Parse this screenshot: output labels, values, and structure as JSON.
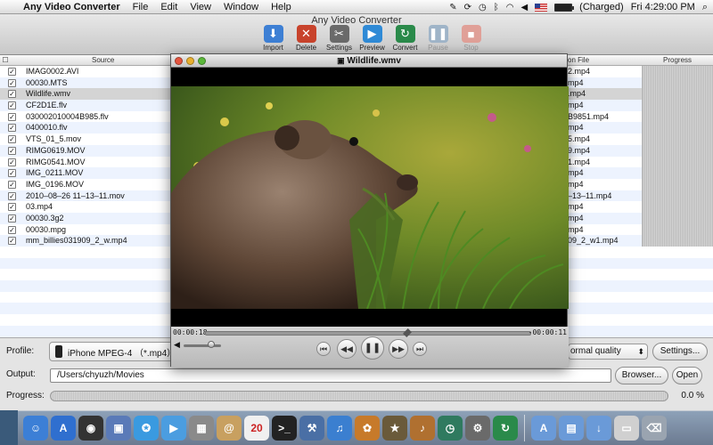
{
  "menubar": {
    "app_name": "Any Video Converter",
    "items": [
      "File",
      "Edit",
      "View",
      "Window",
      "Help"
    ],
    "battery": "(Charged)",
    "clock": "Fri 4:29:00 PM"
  },
  "window": {
    "title": "Any Video Converter"
  },
  "toolbar": {
    "buttons": [
      {
        "label": "Import",
        "icon": "import-icon",
        "color": "#3d7fd4"
      },
      {
        "label": "Delete",
        "icon": "delete-icon",
        "color": "#c8432c"
      },
      {
        "label": "Settings",
        "icon": "settings-icon",
        "color": "#6a6a6a"
      },
      {
        "label": "Preview",
        "icon": "preview-icon",
        "color": "#2f8ad6"
      },
      {
        "label": "Convert",
        "icon": "convert-icon",
        "color": "#2a8a4a"
      },
      {
        "label": "Pause",
        "icon": "pause-icon",
        "color": "#9fb4c8"
      },
      {
        "label": "Stop",
        "icon": "stop-icon",
        "color": "#e0a098"
      }
    ]
  },
  "table": {
    "headers": {
      "source": "Source",
      "dest": "on File",
      "progress": "Progress"
    },
    "rows": [
      {
        "source": "IMAG0002.AVI",
        "dest": "2.mp4",
        "checked": "✓"
      },
      {
        "source": "00030.MTS",
        "dest": "mp4",
        "checked": "✓"
      },
      {
        "source": "Wildlife.wmv",
        "dest": ".mp4",
        "checked": "✓"
      },
      {
        "source": "CF2D1E.flv",
        "dest": "mp4",
        "checked": "✓"
      },
      {
        "source": "030002010004B985.flv",
        "dest": "B9851.mp4",
        "checked": "✓"
      },
      {
        "source": "0400010.flv",
        "dest": "mp4",
        "checked": "✓"
      },
      {
        "source": "VTS_01_5.mov",
        "dest": "5.mp4",
        "checked": "✓"
      },
      {
        "source": "RIMG0619.MOV",
        "dest": "9.mp4",
        "checked": "✓"
      },
      {
        "source": "RIMG0541.MOV",
        "dest": "1.mp4",
        "checked": "✓"
      },
      {
        "source": "IMG_0211.MOV",
        "dest": "mp4",
        "checked": "✓"
      },
      {
        "source": "IMG_0196.MOV",
        "dest": "mp4",
        "checked": "✓"
      },
      {
        "source": "2010–08–26 11–13–11.mov",
        "dest": "–13–11.mp4",
        "checked": "✓"
      },
      {
        "source": "03.mp4",
        "dest": "mp4",
        "checked": "✓"
      },
      {
        "source": "00030.3g2",
        "dest": "mp4",
        "checked": "✓"
      },
      {
        "source": "00030.mpg",
        "dest": "mp4",
        "checked": "✓"
      },
      {
        "source": "mm_billies031909_2_w.mp4",
        "dest": "09_2_w1.mp4",
        "checked": "✓"
      }
    ]
  },
  "bottom": {
    "profile_label": "Profile:",
    "profile_value": "iPhone MPEG-4 （*.mp4）",
    "quality_value": "ormal quality",
    "settings_button": "Settings...",
    "output_label": "Output:",
    "output_path": "/Users/chyuzh/Movies",
    "browser_button": "Browser...",
    "open_button": "Open",
    "progress_label": "Progress:",
    "progress_value": "0.0 %",
    "progress_fraction": 0.0
  },
  "player": {
    "title": "Wildlife.wmv",
    "elapsed": "00:00:18",
    "remaining": "-00:00:11",
    "position_fraction": 0.62,
    "volume_fraction": 0.75
  },
  "dock": {
    "icons": [
      {
        "name": "finder-icon",
        "color": "#3c7fd6",
        "glyph": "☺"
      },
      {
        "name": "app-store-icon",
        "color": "#2f6fcf",
        "glyph": "A"
      },
      {
        "name": "dashboard-icon",
        "color": "#333333",
        "glyph": "◉"
      },
      {
        "name": "preview-app-icon",
        "color": "#5a7ab8",
        "glyph": "▣"
      },
      {
        "name": "safari-icon",
        "color": "#3a9ae0",
        "glyph": "✪"
      },
      {
        "name": "facetime-icon",
        "color": "#4b9de0",
        "glyph": "▶"
      },
      {
        "name": "calculator-icon",
        "color": "#8a8a8a",
        "glyph": "▦"
      },
      {
        "name": "address-book-icon",
        "color": "#c8a060",
        "glyph": "@"
      },
      {
        "name": "calendar-icon",
        "color": "#f0f0f0",
        "glyph": "20"
      },
      {
        "name": "terminal-icon",
        "color": "#222222",
        "glyph": ">_"
      },
      {
        "name": "xcode-icon",
        "color": "#4a6fa5",
        "glyph": "⚒"
      },
      {
        "name": "itunes-icon",
        "color": "#3b7fd0",
        "glyph": "♫"
      },
      {
        "name": "photo-icon",
        "color": "#c77a2a",
        "glyph": "✿"
      },
      {
        "name": "imovie-icon",
        "color": "#6a5a3a",
        "glyph": "★"
      },
      {
        "name": "garageband-icon",
        "color": "#b07030",
        "glyph": "♪"
      },
      {
        "name": "time-machine-icon",
        "color": "#2f7a5f",
        "glyph": "◷"
      },
      {
        "name": "system-preferences-icon",
        "color": "#6a6a6a",
        "glyph": "⚙"
      },
      {
        "name": "video-converter-icon",
        "color": "#2a8a4a",
        "glyph": "↻"
      },
      {
        "name": "applications-folder-icon",
        "color": "#6a9ad8",
        "glyph": "A"
      },
      {
        "name": "documents-folder-icon",
        "color": "#6a9ad8",
        "glyph": "▤"
      },
      {
        "name": "downloads-folder-icon",
        "color": "#6a9ad8",
        "glyph": "↓"
      },
      {
        "name": "stack-icon",
        "color": "#d0d0d0",
        "glyph": "▭"
      },
      {
        "name": "trash-icon",
        "color": "#9aa4b0",
        "glyph": "⌫"
      }
    ]
  }
}
